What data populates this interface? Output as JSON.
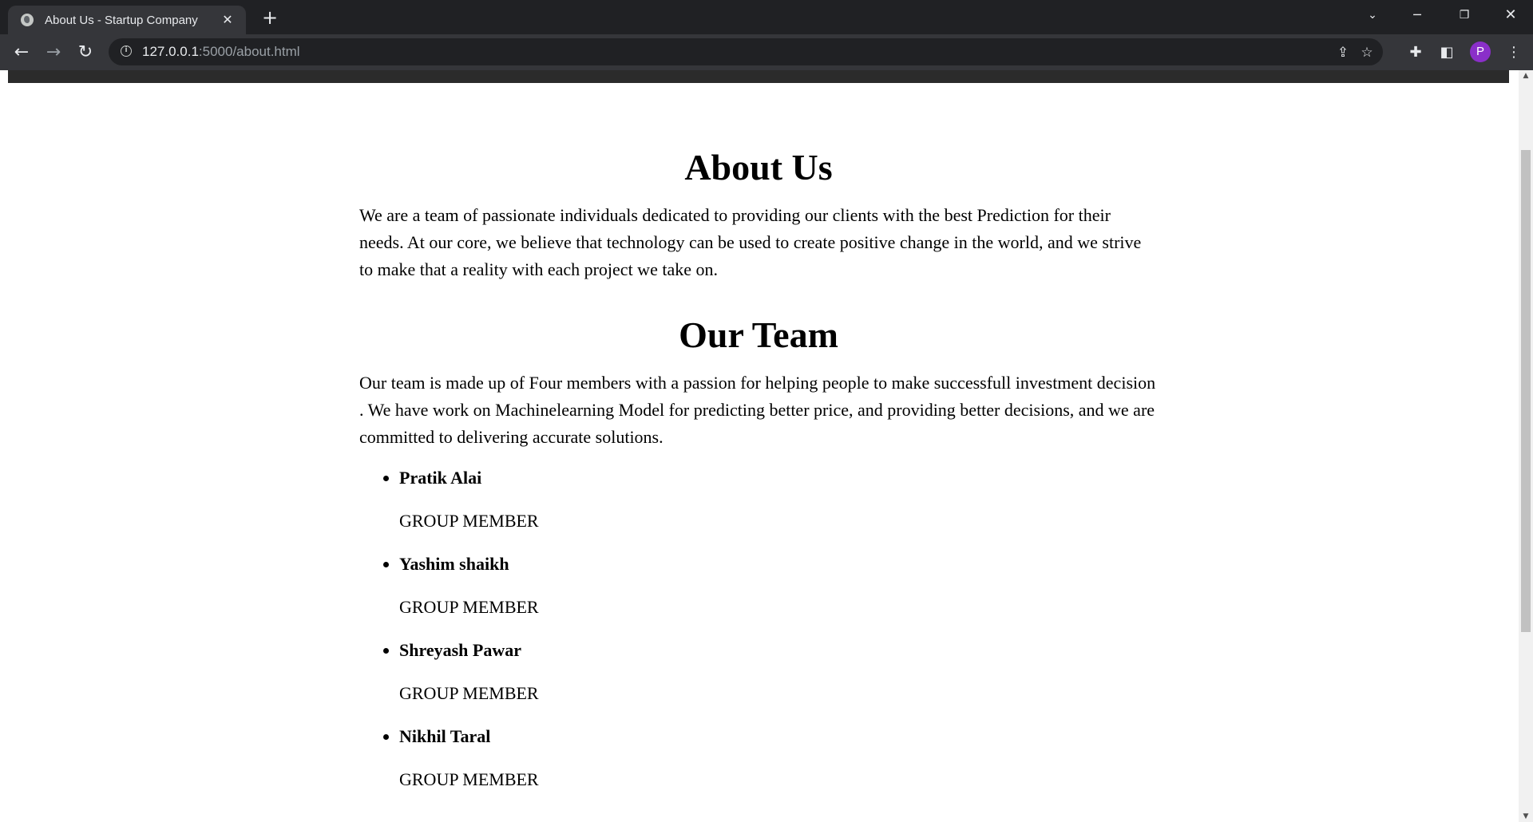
{
  "browser": {
    "tab_title": "About Us - Startup Company",
    "url_host": "127.0.0.1",
    "url_rest": ":5000/about.html",
    "profile_initial": "P"
  },
  "page": {
    "about_heading": "About Us",
    "about_text": "We are a team of passionate individuals dedicated to providing our clients with the best Prediction for their needs. At our core, we believe that technology can be used to create positive change in the world, and we strive to make that a reality with each project we take on.",
    "team_heading": "Our Team",
    "team_text": "Our team is made up of Four members with a passion for helping people to make successfull investment decision . We have work on Machinelearning Model for predicting better price, and providing better decisions, and we are committed to delivering accurate solutions.",
    "members": [
      {
        "name": "Pratik Alai",
        "role": "GROUP MEMBER"
      },
      {
        "name": "Yashim shaikh",
        "role": "GROUP MEMBER"
      },
      {
        "name": "Shreyash Pawar",
        "role": "GROUP MEMBER"
      },
      {
        "name": "Nikhil Taral",
        "role": "GROUP MEMBER"
      }
    ]
  },
  "icons": {
    "tab_favicon": "globe-icon",
    "tab_close": "close-icon",
    "new_tab": "plus-icon",
    "back": "arrow-left-icon",
    "forward": "arrow-right-icon",
    "reload": "reload-icon",
    "site_info": "info-icon",
    "share": "share-icon",
    "bookmark": "star-icon",
    "extensions": "puzzle-icon",
    "side_panel": "side-panel-icon",
    "menu": "kebab-menu-icon"
  },
  "colors": {
    "chrome_dark": "#202124",
    "chrome_toolbar": "#35363a",
    "avatar": "#8a2fc9",
    "header_strip": "#2b2b2b"
  }
}
